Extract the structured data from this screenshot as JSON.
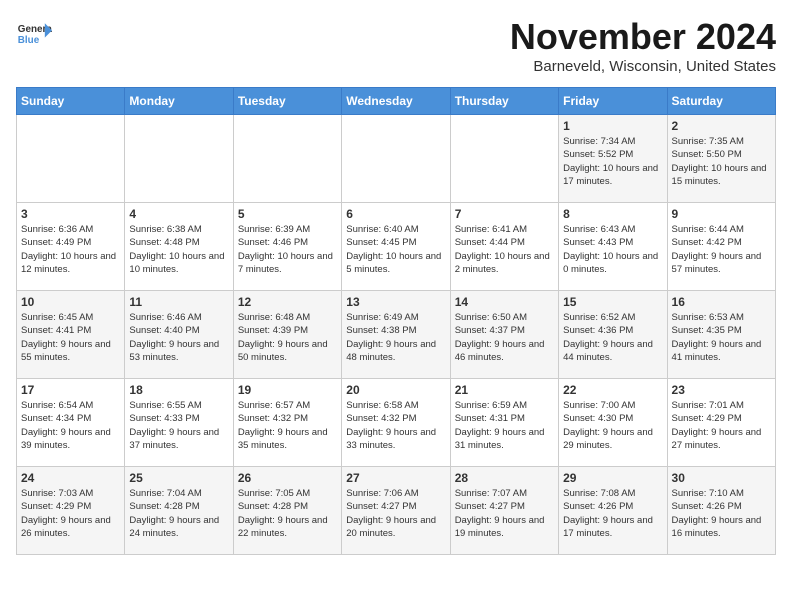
{
  "header": {
    "logo_line1": "General",
    "logo_line2": "Blue",
    "month_title": "November 2024",
    "location": "Barneveld, Wisconsin, United States"
  },
  "days_of_week": [
    "Sunday",
    "Monday",
    "Tuesday",
    "Wednesday",
    "Thursday",
    "Friday",
    "Saturday"
  ],
  "weeks": [
    [
      {
        "day": "",
        "info": ""
      },
      {
        "day": "",
        "info": ""
      },
      {
        "day": "",
        "info": ""
      },
      {
        "day": "",
        "info": ""
      },
      {
        "day": "",
        "info": ""
      },
      {
        "day": "1",
        "info": "Sunrise: 7:34 AM\nSunset: 5:52 PM\nDaylight: 10 hours and 17 minutes."
      },
      {
        "day": "2",
        "info": "Sunrise: 7:35 AM\nSunset: 5:50 PM\nDaylight: 10 hours and 15 minutes."
      }
    ],
    [
      {
        "day": "3",
        "info": "Sunrise: 6:36 AM\nSunset: 4:49 PM\nDaylight: 10 hours and 12 minutes."
      },
      {
        "day": "4",
        "info": "Sunrise: 6:38 AM\nSunset: 4:48 PM\nDaylight: 10 hours and 10 minutes."
      },
      {
        "day": "5",
        "info": "Sunrise: 6:39 AM\nSunset: 4:46 PM\nDaylight: 10 hours and 7 minutes."
      },
      {
        "day": "6",
        "info": "Sunrise: 6:40 AM\nSunset: 4:45 PM\nDaylight: 10 hours and 5 minutes."
      },
      {
        "day": "7",
        "info": "Sunrise: 6:41 AM\nSunset: 4:44 PM\nDaylight: 10 hours and 2 minutes."
      },
      {
        "day": "8",
        "info": "Sunrise: 6:43 AM\nSunset: 4:43 PM\nDaylight: 10 hours and 0 minutes."
      },
      {
        "day": "9",
        "info": "Sunrise: 6:44 AM\nSunset: 4:42 PM\nDaylight: 9 hours and 57 minutes."
      }
    ],
    [
      {
        "day": "10",
        "info": "Sunrise: 6:45 AM\nSunset: 4:41 PM\nDaylight: 9 hours and 55 minutes."
      },
      {
        "day": "11",
        "info": "Sunrise: 6:46 AM\nSunset: 4:40 PM\nDaylight: 9 hours and 53 minutes."
      },
      {
        "day": "12",
        "info": "Sunrise: 6:48 AM\nSunset: 4:39 PM\nDaylight: 9 hours and 50 minutes."
      },
      {
        "day": "13",
        "info": "Sunrise: 6:49 AM\nSunset: 4:38 PM\nDaylight: 9 hours and 48 minutes."
      },
      {
        "day": "14",
        "info": "Sunrise: 6:50 AM\nSunset: 4:37 PM\nDaylight: 9 hours and 46 minutes."
      },
      {
        "day": "15",
        "info": "Sunrise: 6:52 AM\nSunset: 4:36 PM\nDaylight: 9 hours and 44 minutes."
      },
      {
        "day": "16",
        "info": "Sunrise: 6:53 AM\nSunset: 4:35 PM\nDaylight: 9 hours and 41 minutes."
      }
    ],
    [
      {
        "day": "17",
        "info": "Sunrise: 6:54 AM\nSunset: 4:34 PM\nDaylight: 9 hours and 39 minutes."
      },
      {
        "day": "18",
        "info": "Sunrise: 6:55 AM\nSunset: 4:33 PM\nDaylight: 9 hours and 37 minutes."
      },
      {
        "day": "19",
        "info": "Sunrise: 6:57 AM\nSunset: 4:32 PM\nDaylight: 9 hours and 35 minutes."
      },
      {
        "day": "20",
        "info": "Sunrise: 6:58 AM\nSunset: 4:32 PM\nDaylight: 9 hours and 33 minutes."
      },
      {
        "day": "21",
        "info": "Sunrise: 6:59 AM\nSunset: 4:31 PM\nDaylight: 9 hours and 31 minutes."
      },
      {
        "day": "22",
        "info": "Sunrise: 7:00 AM\nSunset: 4:30 PM\nDaylight: 9 hours and 29 minutes."
      },
      {
        "day": "23",
        "info": "Sunrise: 7:01 AM\nSunset: 4:29 PM\nDaylight: 9 hours and 27 minutes."
      }
    ],
    [
      {
        "day": "24",
        "info": "Sunrise: 7:03 AM\nSunset: 4:29 PM\nDaylight: 9 hours and 26 minutes."
      },
      {
        "day": "25",
        "info": "Sunrise: 7:04 AM\nSunset: 4:28 PM\nDaylight: 9 hours and 24 minutes."
      },
      {
        "day": "26",
        "info": "Sunrise: 7:05 AM\nSunset: 4:28 PM\nDaylight: 9 hours and 22 minutes."
      },
      {
        "day": "27",
        "info": "Sunrise: 7:06 AM\nSunset: 4:27 PM\nDaylight: 9 hours and 20 minutes."
      },
      {
        "day": "28",
        "info": "Sunrise: 7:07 AM\nSunset: 4:27 PM\nDaylight: 9 hours and 19 minutes."
      },
      {
        "day": "29",
        "info": "Sunrise: 7:08 AM\nSunset: 4:26 PM\nDaylight: 9 hours and 17 minutes."
      },
      {
        "day": "30",
        "info": "Sunrise: 7:10 AM\nSunset: 4:26 PM\nDaylight: 9 hours and 16 minutes."
      }
    ]
  ]
}
